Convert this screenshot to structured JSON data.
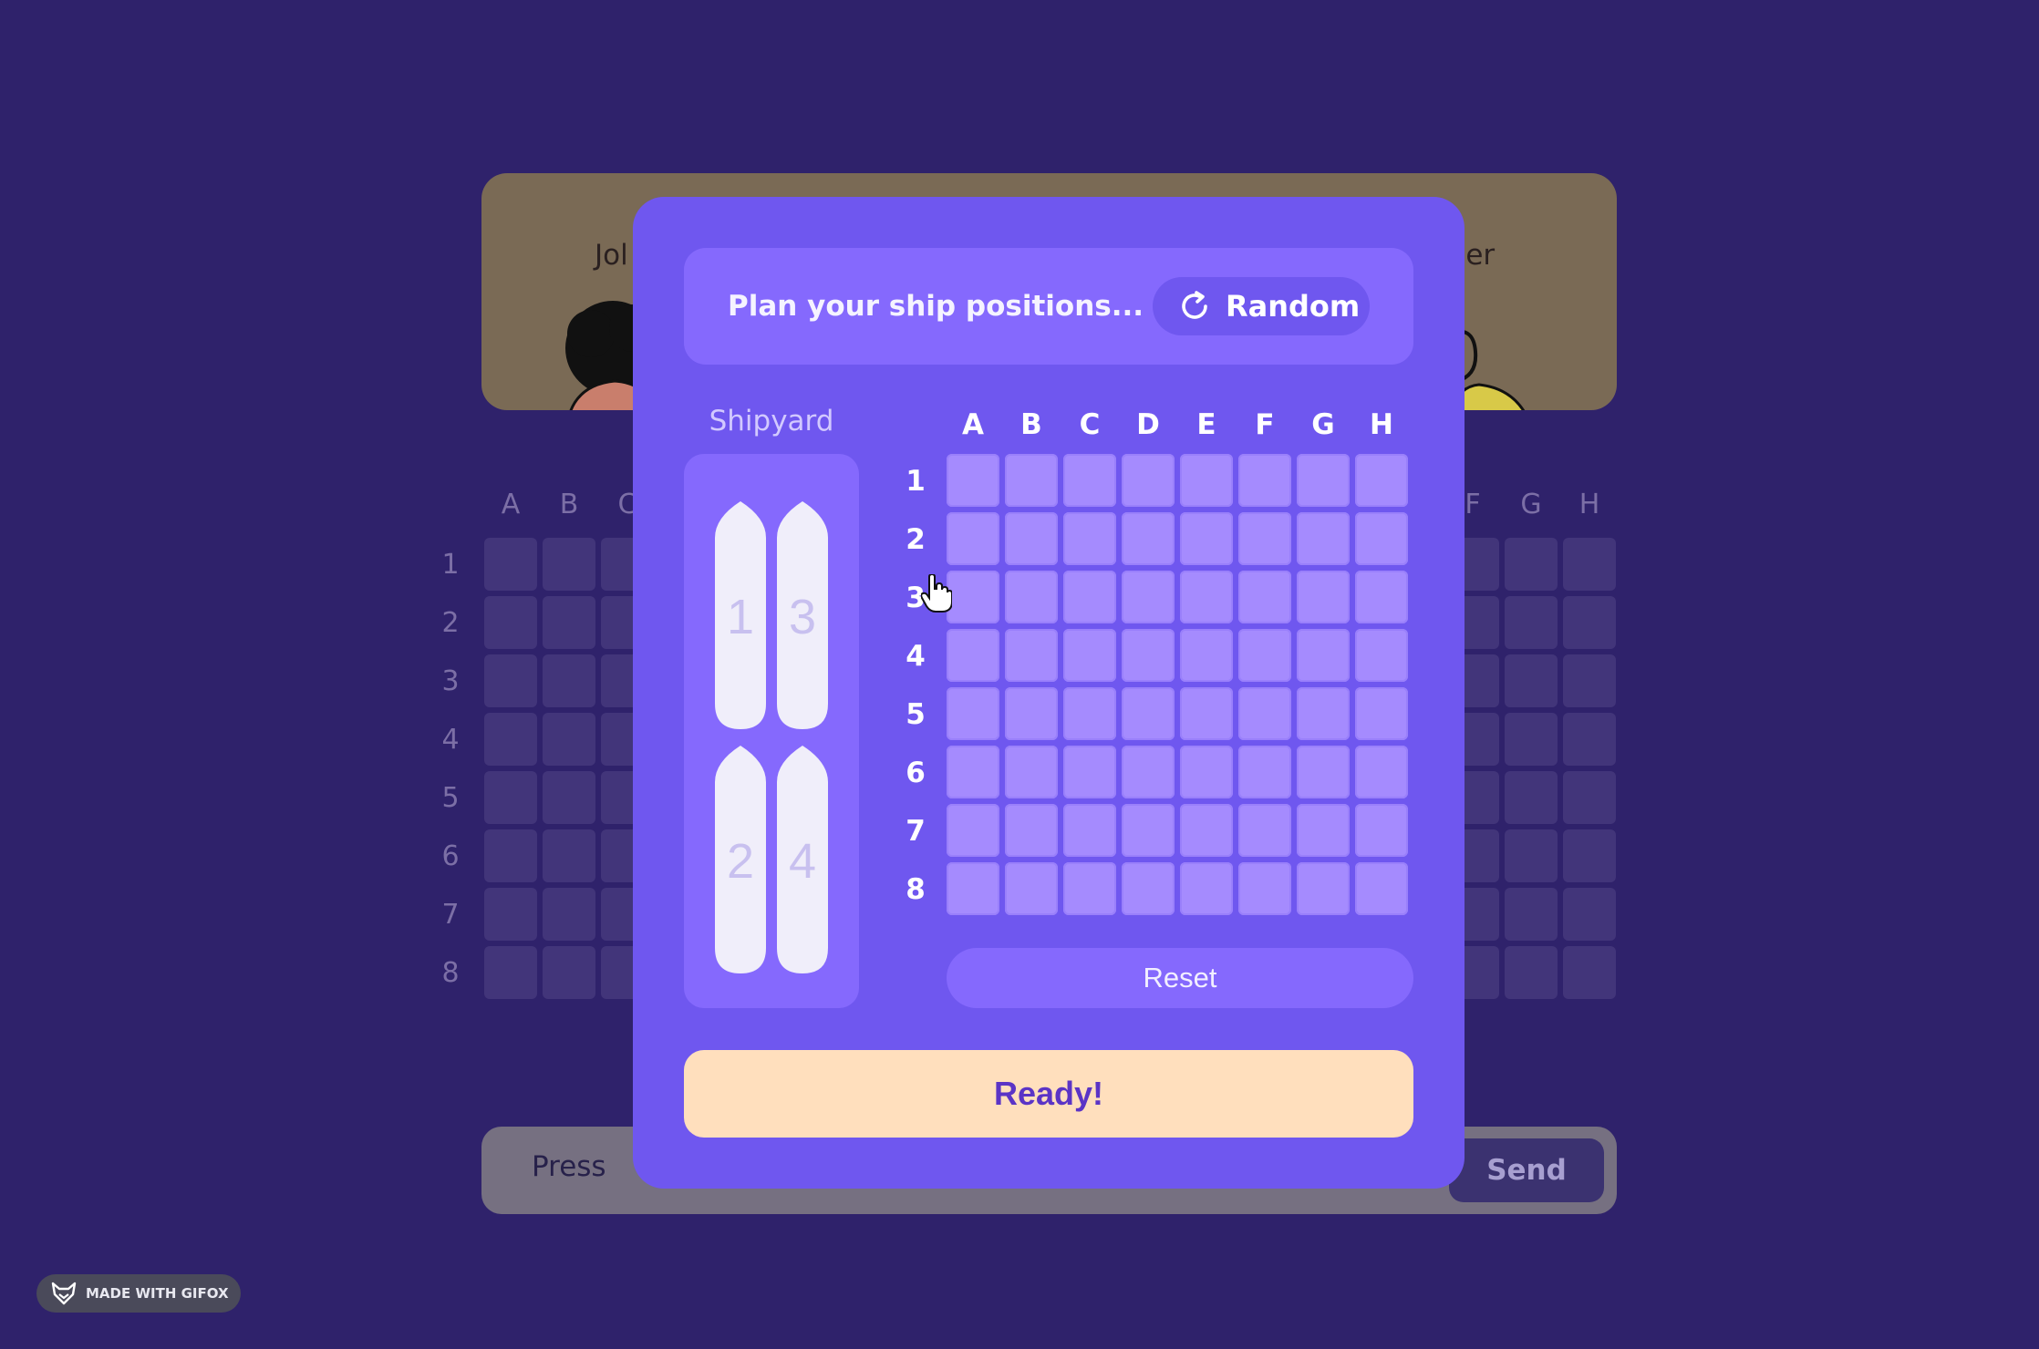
{
  "background": {
    "players": {
      "left_name": "Jol",
      "right_name": "nger"
    },
    "board_left": {
      "columns": [
        "A",
        "B",
        "C"
      ],
      "rows": [
        "1",
        "2",
        "3",
        "4",
        "5",
        "6",
        "7",
        "8"
      ]
    },
    "board_right": {
      "columns": [
        "F",
        "G",
        "H"
      ]
    },
    "chat": {
      "press_text": "Press",
      "send_label": "Send"
    }
  },
  "modal": {
    "title": "Plan your ship positions...",
    "random_label": "Random",
    "shipyard_title": "Shipyard",
    "ships": [
      "1",
      "3",
      "2",
      "4"
    ],
    "columns": [
      "A",
      "B",
      "C",
      "D",
      "E",
      "F",
      "G",
      "H"
    ],
    "rows": [
      "1",
      "2",
      "3",
      "4",
      "5",
      "6",
      "7",
      "8"
    ],
    "reset_label": "Reset",
    "ready_label": "Ready!"
  },
  "badge": {
    "text": "MADE WITH GIFOX",
    "icon": "fox-icon"
  },
  "colors": {
    "page_bg": "#2f226b",
    "modal_bg": "#6f57ef",
    "panel_bg": "#8569fd",
    "cell_bg": "#a58bfe",
    "ready_bg": "#ffdfbd",
    "ready_text": "#5b34c6"
  }
}
